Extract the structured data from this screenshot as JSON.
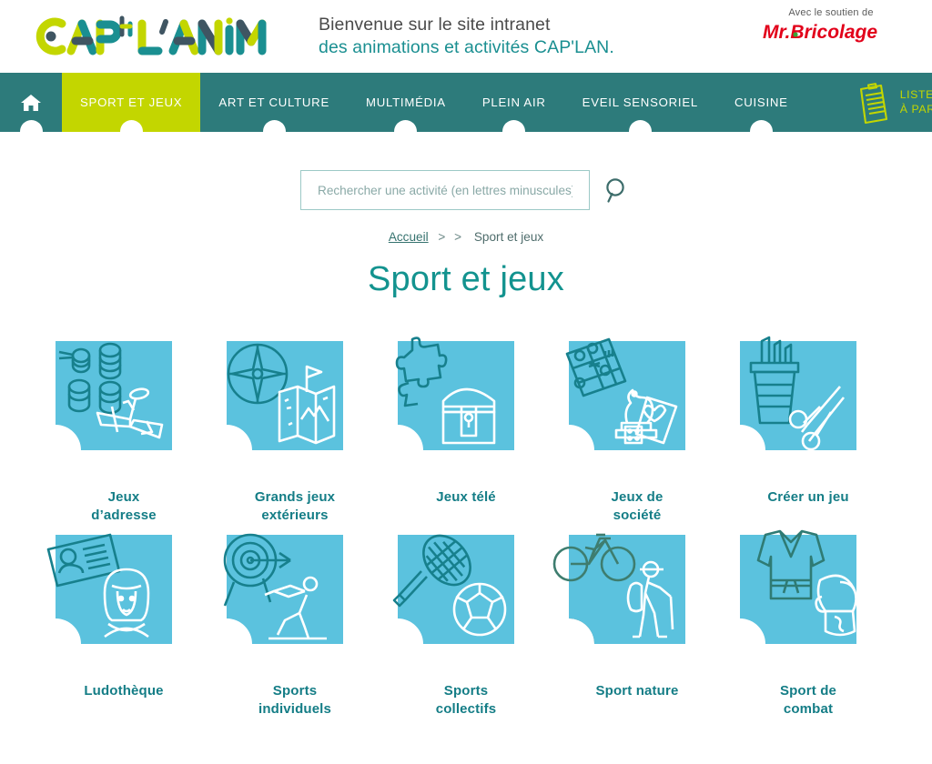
{
  "header": {
    "logo_text": "CAP'L'ANIM",
    "welcome_line1": "Bienvenue sur le site intranet",
    "welcome_line2": "des animations et activités CAP'LAN.",
    "sponsor_prefix": "Avec le soutien de",
    "sponsor_brand": "Mr.Bricolage"
  },
  "nav": {
    "home_icon": "home-icon",
    "items": [
      {
        "label": "SPORT ET JEUX",
        "active": true
      },
      {
        "label": "ART ET CULTURE",
        "active": false
      },
      {
        "label": "MULTIMÉDIA",
        "active": false
      },
      {
        "label": "PLEIN AIR",
        "active": false
      },
      {
        "label": "EVEIL SENSORIEL",
        "active": false
      },
      {
        "label": "CUISINE",
        "active": false
      }
    ],
    "material_line1": "LISTE DU MATÉRIEL",
    "material_line2": "À PARTAGER",
    "material_icon": "clipboard-icon"
  },
  "search": {
    "placeholder": "Rechercher une activité (en lettres minuscules)",
    "value": "",
    "icon": "search-icon"
  },
  "breadcrumb": {
    "home": "Accueil",
    "separator": "> >",
    "current": "Sport et jeux"
  },
  "page_title": "Sport et jeux",
  "categories": [
    {
      "label_line1": "Jeux",
      "label_line2": "d’adresse",
      "icon": "cans-and-plane-icon"
    },
    {
      "label_line1": "Grands jeux",
      "label_line2": "extérieurs",
      "icon": "compass-and-map-icon"
    },
    {
      "label_line1": "Jeux télé",
      "label_line2": "",
      "icon": "puzzle-and-chest-icon"
    },
    {
      "label_line1": "Jeux de",
      "label_line2": "société",
      "icon": "boardgame-cards-icon"
    },
    {
      "label_line1": "Créer un jeu",
      "label_line2": "",
      "icon": "pencils-and-scissors-icon"
    },
    {
      "label_line1": "Ludothèque",
      "label_line2": "",
      "icon": "card-and-person-icon"
    },
    {
      "label_line1": "Sports",
      "label_line2": "individuels",
      "icon": "target-and-runner-icon"
    },
    {
      "label_line1": "Sports",
      "label_line2": "collectifs",
      "icon": "racket-and-ball-icon"
    },
    {
      "label_line1": "Sport nature",
      "label_line2": "",
      "icon": "bike-and-hiker-icon"
    },
    {
      "label_line1": "Sport de",
      "label_line2": "combat",
      "icon": "judogi-and-glove-icon"
    }
  ],
  "colors": {
    "nav_teal": "#2d7b7b",
    "nav_active_green": "#c3d600",
    "title_teal": "#13938f",
    "tile_blue": "#5bc2de",
    "tile_dark": "#17808d",
    "tile_white": "#ffffff",
    "sponsor_red": "#e2001a"
  }
}
